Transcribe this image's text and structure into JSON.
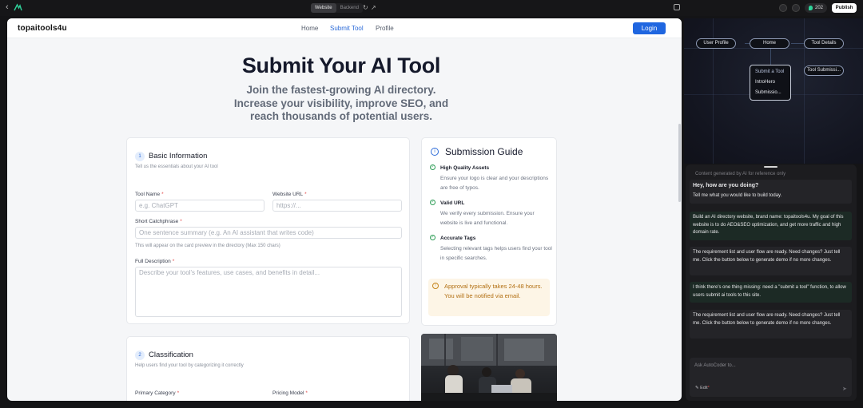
{
  "topbar": {
    "back_glyph": "‹",
    "tabs": [
      {
        "label": "Website",
        "active": true
      },
      {
        "label": "Backend",
        "active": false
      }
    ],
    "credits": "202",
    "publish_label": "Publish"
  },
  "site": {
    "brand": "topaitools4u",
    "nav": [
      {
        "label": "Home",
        "active": false
      },
      {
        "label": "Submit Tool",
        "active": true
      },
      {
        "label": "Profile",
        "active": false
      }
    ],
    "login_label": "Login",
    "hero": {
      "title": "Submit Your AI Tool",
      "subtitle": "Join the fastest-growing AI directory. Increase your visibility, improve SEO, and reach thousands of potential users."
    },
    "basic": {
      "num": "1",
      "title": "Basic Information",
      "subtitle": "Tell us the essentials about your AI tool",
      "tool_name_label": "Tool Name",
      "tool_name_placeholder": "e.g. ChatGPT",
      "website_label": "Website URL",
      "website_placeholder": "https://...",
      "catchphrase_label": "Short Catchphrase",
      "catchphrase_placeholder": "One sentence summary (e.g. An AI assistant that writes code)",
      "catchphrase_hint": "This will appear on the card preview in the directory (Max 150 chars)",
      "description_label": "Full Description",
      "description_placeholder": "Describe your tool's features, use cases, and benefits in detail...",
      "required_mark": "*"
    },
    "classification": {
      "num": "2",
      "title": "Classification",
      "subtitle": "Help users find your tool by categorizing it correctly",
      "category_label": "Primary Category",
      "pricing_label": "Pricing Model"
    },
    "guide": {
      "icon": "i",
      "title": "Submission Guide",
      "items": [
        {
          "title": "High Quality Assets",
          "desc": "Ensure your logo is clear and your descriptions are free of typos."
        },
        {
          "title": "Valid URL",
          "desc": "We verify every submission. Ensure your website is live and functional."
        },
        {
          "title": "Accurate Tags",
          "desc": "Selecting relevant tags helps users find your tool in specific searches."
        }
      ],
      "approval_icon": "!",
      "approval": "Approval typically takes 24-48 hours. You will be notified via email."
    }
  },
  "flow": {
    "nodes": [
      "User Profile",
      "Home",
      "Tool Details",
      "Tool Submissi..."
    ],
    "popup": [
      "Submit a Tool",
      "IntroHero",
      "Submissio..."
    ]
  },
  "chat": {
    "note": "Content generated by AI for reference only",
    "greeting_title": "Hey, how are you doing?",
    "greeting_body": "Tell me what you would like to build today.",
    "messages": [
      {
        "role": "user",
        "text": "Build an AI directory website, brand name: topaitools4u. My goal of this website is to do AEO&SEO optimization, and get more traffic and high domain rate."
      },
      {
        "role": "assistant",
        "text": "The requirement list and user flow are ready. Need changes? Just tell me. Click the button below to generate demo if no more changes."
      },
      {
        "role": "user",
        "text": "I think there's one thing missing: need a \"submit a tool\" function, to allow users submit ai tools to this site."
      },
      {
        "role": "assistant",
        "text": "The requirement list and user flow are ready. Need changes? Just tell me. Click the button below to generate demo if no more changes."
      }
    ],
    "input_placeholder": "Ask AutoCoder to...",
    "edit_label": "Edit",
    "edit_mark": "*",
    "send_glyph": "➤"
  }
}
